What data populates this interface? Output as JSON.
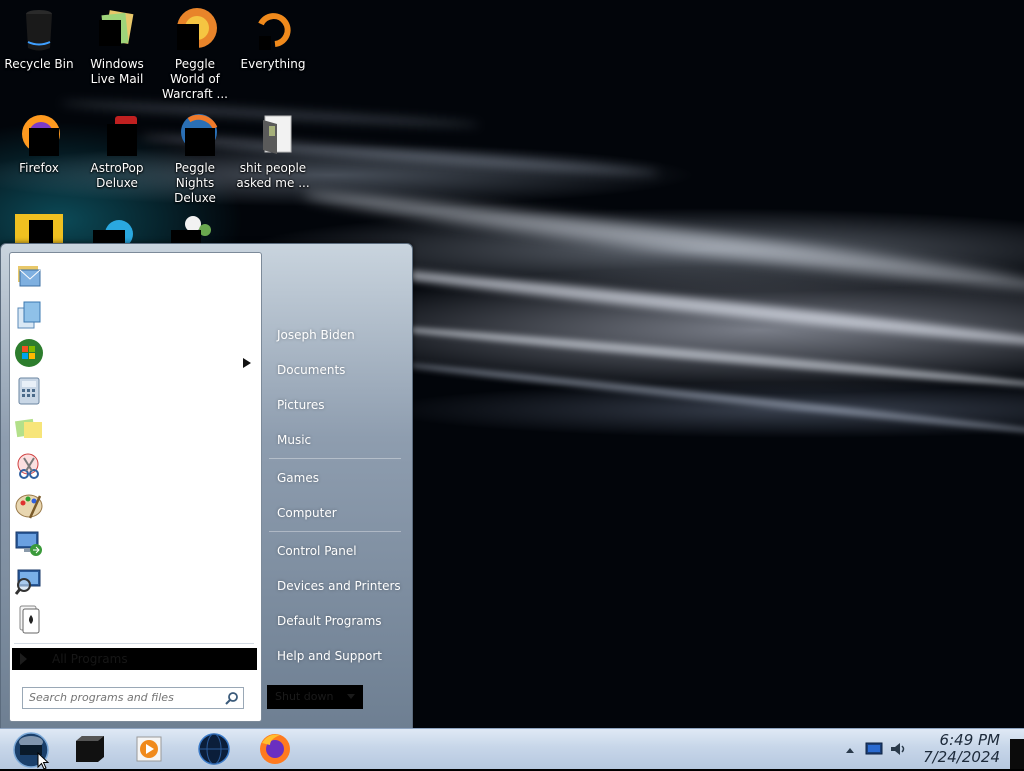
{
  "desktop": {
    "icons": [
      {
        "label": "Recycle Bin"
      },
      {
        "label": "Windows Live Mail"
      },
      {
        "label": "Peggle World of Warcraft ..."
      },
      {
        "label": "Everything"
      },
      {
        "label": "Firefox"
      },
      {
        "label": "AstroPop Deluxe"
      },
      {
        "label": "Peggle Nights Deluxe"
      },
      {
        "label": "shit people asked me ..."
      }
    ]
  },
  "start_menu": {
    "programs": [
      {
        "icon": "mail-icon"
      },
      {
        "icon": "getting-started-icon"
      },
      {
        "icon": "windows-logo-icon"
      },
      {
        "icon": "calculator-icon"
      },
      {
        "icon": "sticky-notes-icon"
      },
      {
        "icon": "snipping-tool-icon"
      },
      {
        "icon": "paint-icon"
      },
      {
        "icon": "remote-desktop-icon"
      },
      {
        "icon": "magnifier-icon"
      },
      {
        "icon": "solitaire-icon"
      }
    ],
    "all_programs_label": "All Programs",
    "search_placeholder": "Search programs and files",
    "right_items": [
      {
        "label": "Joseph Biden"
      },
      {
        "label": "Documents"
      },
      {
        "label": "Pictures"
      },
      {
        "label": "Music"
      },
      {
        "label": "Games"
      },
      {
        "label": "Computer"
      },
      {
        "label": "Control Panel"
      },
      {
        "label": "Devices and Printers"
      },
      {
        "label": "Default Programs"
      },
      {
        "label": "Help and Support"
      }
    ],
    "shutdown_label": "Shut down"
  },
  "taskbar": {
    "pinned": [
      {
        "icon": "media-center-icon"
      },
      {
        "icon": "media-player-icon"
      },
      {
        "icon": "globe-icon"
      },
      {
        "icon": "firefox-icon"
      }
    ],
    "clock": {
      "time": "6:49 PM",
      "date": "7/24/2024"
    }
  }
}
